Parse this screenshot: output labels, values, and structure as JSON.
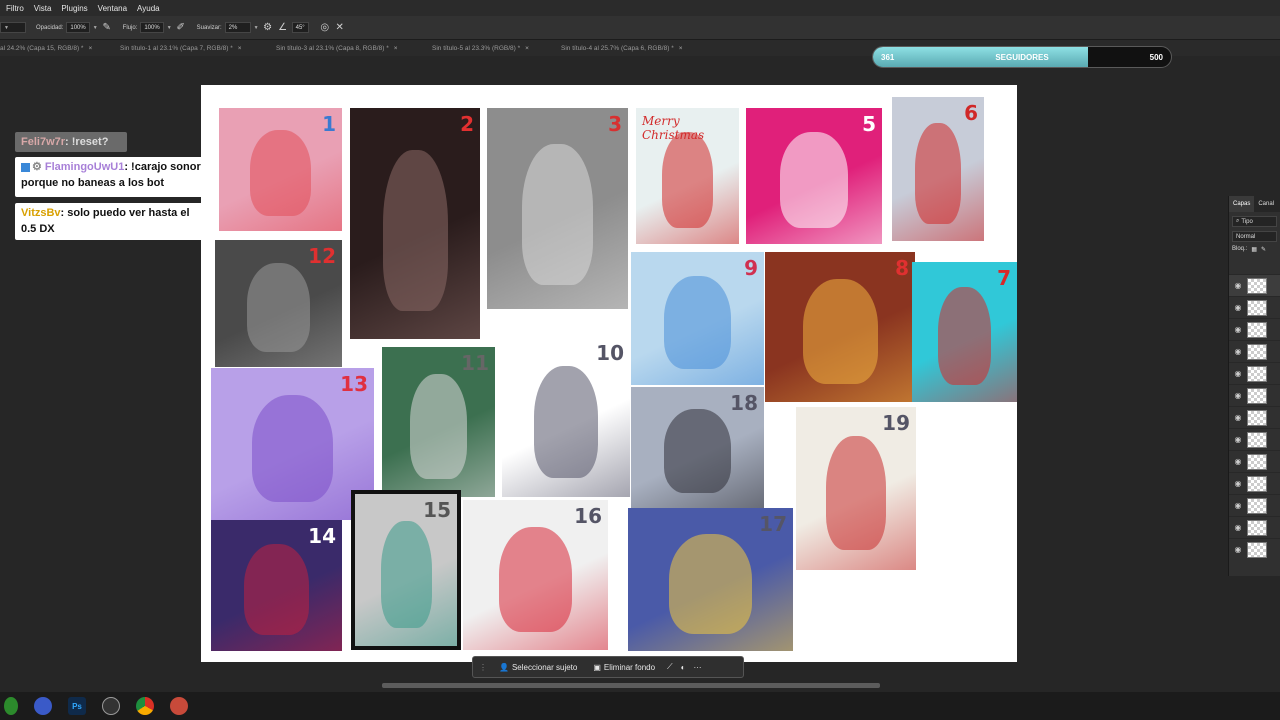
{
  "menu": [
    "Filtro",
    "Vista",
    "Plugins",
    "Ventana",
    "Ayuda"
  ],
  "options": {
    "opacity_label": "Opacidad:",
    "opacity_value": "100%",
    "flow_label": "Flujo:",
    "flow_value": "100%",
    "smooth_label": "Suavizar:",
    "smooth_value": "2%",
    "angle_value": "45°"
  },
  "doc_tabs": [
    "al 24.2% (Capa 15, RGB/8) *",
    "Sin título-1 al 23.1% (Capa 7, RGB/8) *",
    "Sin título-3 al 23.1% (Capa 8, RGB/8) *",
    "Sin título-5 al 23.3% (RGB/8) *",
    "Sin título-4 al 25.7% (Capa 6, RGB/8) *"
  ],
  "followers": {
    "current": "361",
    "label": "SEGUIDORES",
    "goal": "500",
    "progress": 0.722
  },
  "chat": [
    {
      "user": "Feli7w7r",
      "message": ": !reset?",
      "user_color": "#b58888",
      "faded": true
    },
    {
      "user": "FlamingoUwU1",
      "message": ": !carajo sonor porque no baneas a los bot",
      "user_color": "#a880d8"
    },
    {
      "user": "VitzsBv",
      "message": ": solo puedo ver hasta el 0.5 DX",
      "user_color": "#d8a000"
    }
  ],
  "artworks": [
    {
      "n": "1",
      "bg": "#e9a0b4",
      "accent": "#e24f5a",
      "num_color": "#3a7ad0"
    },
    {
      "n": "2",
      "bg": "#2a1c1c",
      "accent": "#8a6a66",
      "num_color": "#e23030"
    },
    {
      "n": "3",
      "bg": "#8d8d8d",
      "accent": "#d8d8d8",
      "num_color": "#d83030"
    },
    {
      "n": "",
      "bg": "#e8f0f0",
      "accent": "#d22a2a",
      "num_color": "#d22a2a",
      "caption": "Merry Christmas"
    },
    {
      "n": "5",
      "bg": "#e0207a",
      "accent": "#ffffff",
      "num_color": "#ffffff"
    },
    {
      "n": "6",
      "bg": "#c7ccd8",
      "accent": "#d02828",
      "num_color": "#d02828"
    },
    {
      "n": "12",
      "bg": "#4a4a4a",
      "accent": "#999999",
      "num_color": "#e03030"
    },
    {
      "n": "9",
      "bg": "#b9d8ee",
      "accent": "#4a8fd8",
      "num_color": "#d03050"
    },
    {
      "n": "8",
      "bg": "#8a3420",
      "accent": "#f0b040",
      "num_color": "#e03030"
    },
    {
      "n": "7",
      "bg": "#30c8d8",
      "accent": "#d82828",
      "num_color": "#d82828"
    },
    {
      "n": "13",
      "bg": "#b8a0e8",
      "accent": "#7b4fc8",
      "num_color": "#e03040"
    },
    {
      "n": "11",
      "bg": "#3c7050",
      "accent": "#d8d8d8",
      "num_color": "#666666"
    },
    {
      "n": "10",
      "bg": "#ffffff",
      "accent": "#55556a",
      "num_color": "#555566"
    },
    {
      "n": "18",
      "bg": "#a8b0c0",
      "accent": "#303038",
      "num_color": "#555566"
    },
    {
      "n": "19",
      "bg": "#f0ece4",
      "accent": "#c83030",
      "num_color": "#555566"
    },
    {
      "n": "14",
      "bg": "#3a2a6a",
      "accent": "#c02040",
      "num_color": "#ffffff"
    },
    {
      "n": "15",
      "bg": "#c8c8c8",
      "accent": "#3a9a8a",
      "num_color": "#555555"
    },
    {
      "n": "16",
      "bg": "#f0f0f0",
      "accent": "#d82838",
      "num_color": "#555566"
    },
    {
      "n": "17",
      "bg": "#4a5aa8",
      "accent": "#f0c840",
      "num_color": "#555566"
    }
  ],
  "layers_panel": {
    "tabs": [
      "Capas",
      "Canal"
    ],
    "filter": "Tipo",
    "blend": "Normal",
    "lock": "Bloq.:"
  },
  "context_bar": {
    "select_subject": "Seleccionar sujeto",
    "remove_bg": "Eliminar fondo",
    "more": "···"
  },
  "taskbar": [
    "photoshop",
    "chrome",
    "obs",
    "edge"
  ],
  "colors": {
    "panel": "#323232",
    "followers_fill": "#7cd0d6"
  }
}
